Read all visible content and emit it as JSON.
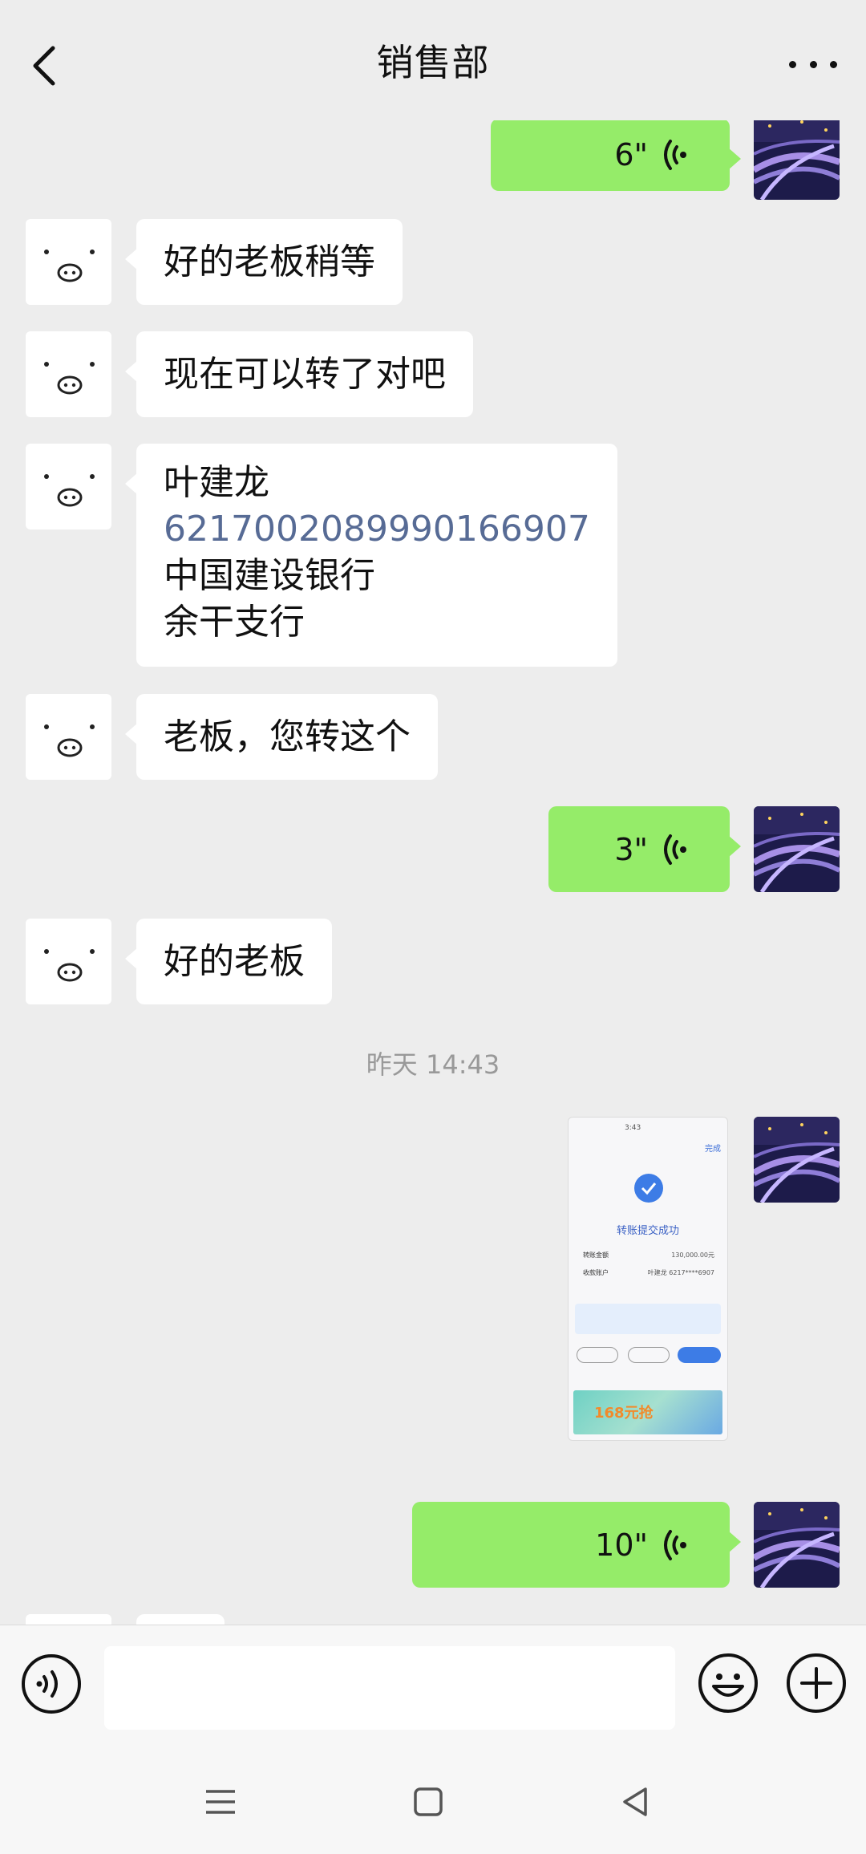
{
  "header": {
    "title": "销售部"
  },
  "messages": {
    "m1": {
      "duration": "6\""
    },
    "m2": {
      "text": "好的老板稍等"
    },
    "m3": {
      "text": "现在可以转了对吧"
    },
    "m4": {
      "name": "叶建龙",
      "account": "6217002089990166907",
      "bank": "中国建设银行",
      "branch": "余干支行"
    },
    "m5": {
      "text": "老板，您转这个"
    },
    "m6": {
      "duration": "3\""
    },
    "m7": {
      "text": "好的老板"
    },
    "time": "昨天 14:43",
    "m8": {
      "status_time": "3:43",
      "done": "完成",
      "heading": "转账提交成功",
      "amount_label": "转账金额",
      "amount_value": "130,000.00元",
      "payee_label": "收款账户",
      "payee_value": "叶建龙 6217****6907",
      "banner_price": "168元抢"
    },
    "m9": {
      "duration": "10\""
    }
  },
  "colors": {
    "self_bubble": "#95ec69",
    "other_bubble": "#ffffff",
    "link": "#576b95",
    "background": "#ededed"
  }
}
